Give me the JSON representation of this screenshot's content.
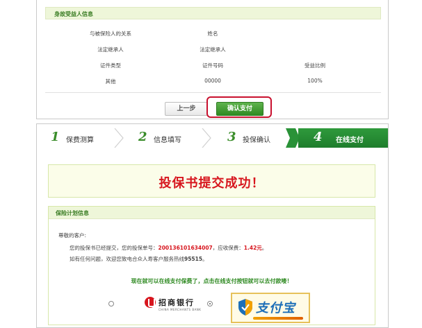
{
  "beneficiary": {
    "section_title": "身故受益人信息",
    "row1": {
      "label1": "与被保险人的关系",
      "label2": "姓名"
    },
    "row2": {
      "value1": "法定继承人",
      "value2": "法定继承人"
    },
    "row3": {
      "label1": "证件类型",
      "label2": "证件号码",
      "label3": "受益比例"
    },
    "row4": {
      "value1": "其他",
      "value2": "00000",
      "value3": "100%"
    }
  },
  "buttons": {
    "prev": "上一步",
    "confirm": "确认支付"
  },
  "steps": [
    {
      "num": "1",
      "label": "保费测算"
    },
    {
      "num": "2",
      "label": "信息填写"
    },
    {
      "num": "3",
      "label": "投保确认"
    },
    {
      "num": "4",
      "label": "在线支付"
    }
  ],
  "success": {
    "message": "投保书提交成功！"
  },
  "plan": {
    "section_title": "保险计划信息",
    "greeting": "尊敬的客户:",
    "line1_pre": "您的投保书已经提交，您的投保单号：",
    "policy_no": "200136101634007",
    "line1_mid": "，应收保费：",
    "premium": "1.42元",
    "line1_post": "。",
    "line2_pre": "如有任何问题，欢迎您致电合众人寿客户服务热线",
    "hotline": "95515",
    "line2_post": "。",
    "notice": "现在就可以在线支付保费了，点击在线支付按钮就可以去付款喽！"
  },
  "payment": {
    "cmb_name": "招商银行",
    "cmb_en": "CHINA MERCHANTS BANK",
    "alipay_name": "支付宝"
  },
  "colors": {
    "accent_green": "#2f8a22",
    "alert_red": "#d7161e"
  }
}
